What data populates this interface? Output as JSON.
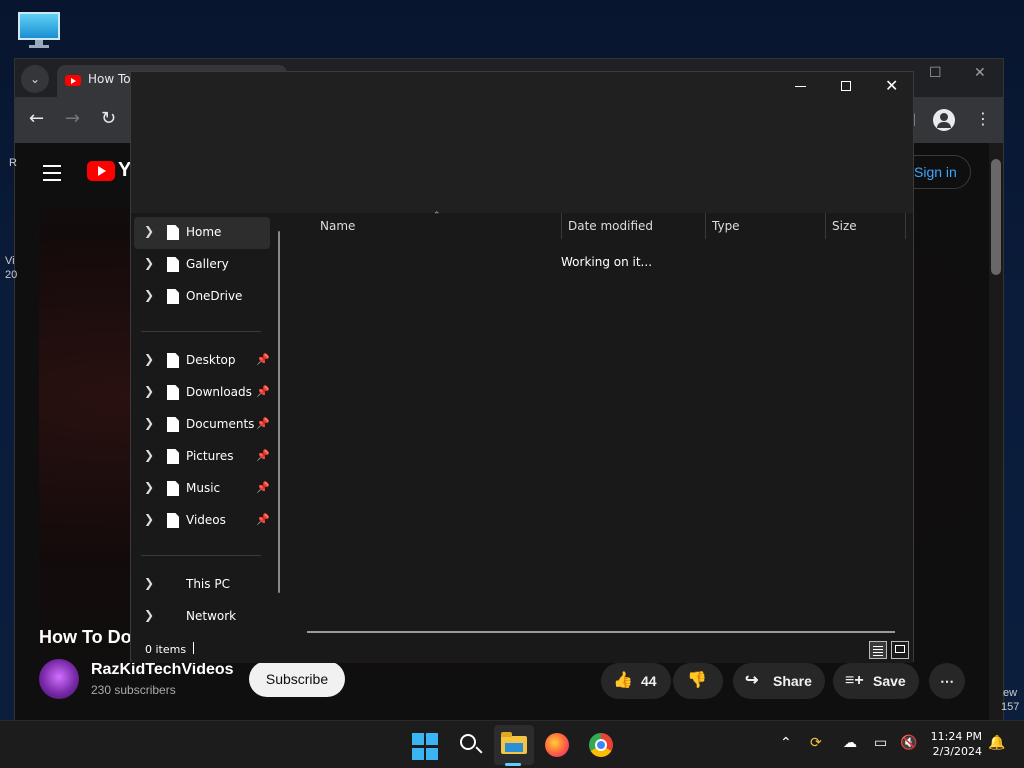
{
  "browser": {
    "tab_title": "How To",
    "tab_dropdown_icon": "chevron-down-icon",
    "nav": {
      "back_icon": "arrow-left-icon",
      "forward_icon": "arrow-right-icon",
      "reload_icon": "reload-icon"
    }
  },
  "youtube": {
    "logo_text": "Yo",
    "sign_in": "Sign in",
    "edge_left": [
      "R",
      "Vi",
      "20"
    ],
    "edge_right": [
      "ew",
      "157"
    ],
    "video_title": "How To Do",
    "channel": {
      "name": "RazKidTechVideos",
      "subscribers": "230 subscribers"
    },
    "subscribe": "Subscribe",
    "like_count": "44",
    "share": "Share",
    "save": "Save"
  },
  "explorer": {
    "nav_items": [
      {
        "label": "Home",
        "selected": true,
        "pinned": false
      },
      {
        "label": "Gallery",
        "pinned": false
      },
      {
        "label": "OneDrive",
        "pinned": false
      },
      {
        "label": "Desktop",
        "pinned": true
      },
      {
        "label": "Downloads",
        "pinned": true
      },
      {
        "label": "Documents",
        "pinned": true
      },
      {
        "label": "Pictures",
        "pinned": true
      },
      {
        "label": "Music",
        "pinned": true
      },
      {
        "label": "Videos",
        "pinned": true
      },
      {
        "label": "This PC",
        "pinned": false
      },
      {
        "label": "Network",
        "pinned": false
      }
    ],
    "columns": [
      "Name",
      "Date modified",
      "Type",
      "Size"
    ],
    "status_message": "Working on it...",
    "item_count": "0 items"
  },
  "taskbar": {
    "time": "11:24 PM",
    "date": "2/3/2024",
    "accent": "#60cdff"
  }
}
